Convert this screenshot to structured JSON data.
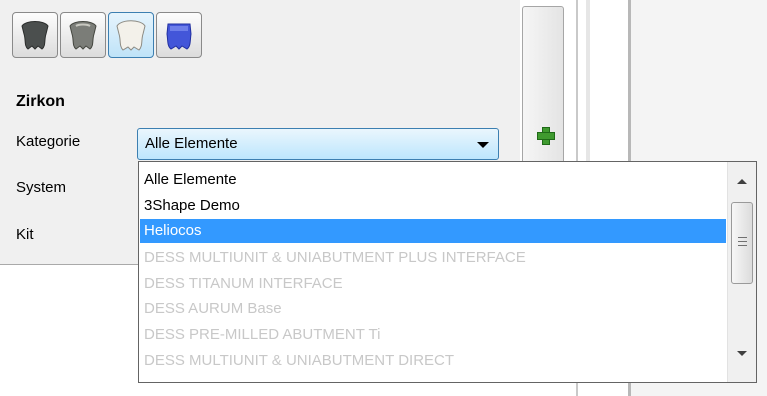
{
  "material_buttons": [
    {
      "icon": "dark-crown-icon",
      "selected": false
    },
    {
      "icon": "metal-crown-icon",
      "selected": false
    },
    {
      "icon": "white-crown-icon",
      "selected": true
    },
    {
      "icon": "blue-crown-icon",
      "selected": false
    }
  ],
  "section": {
    "title": "Zirkon"
  },
  "form": {
    "kategorie_label": "Kategorie",
    "system_label": "System",
    "kit_label": "Kit",
    "kategorie_value": "Alle Elemente"
  },
  "dropdown": {
    "items": [
      {
        "label": "Alle Elemente",
        "state": "normal"
      },
      {
        "label": "3Shape Demo",
        "state": "normal"
      },
      {
        "label": "Heliocos",
        "state": "selected"
      },
      {
        "label": "DESS MULTIUNIT & UNIABUTMENT PLUS INTERFACE",
        "state": "disabled"
      },
      {
        "label": "DESS TITANUM INTERFACE",
        "state": "disabled"
      },
      {
        "label": "DESS AURUM Base",
        "state": "disabled"
      },
      {
        "label": "DESS PRE-MILLED ABUTMENT Ti",
        "state": "disabled"
      },
      {
        "label": "DESS MULTIUNIT & UNIABUTMENT DIRECT",
        "state": "disabled"
      }
    ]
  },
  "colors": {
    "selection": "#3399ff",
    "disabled_text": "#c8c8c8",
    "add_icon": "#3f9a2f"
  }
}
